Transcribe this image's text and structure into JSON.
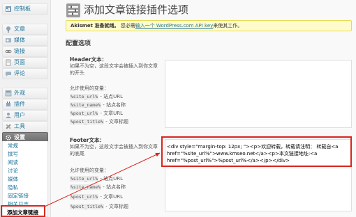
{
  "sidebar": {
    "items": [
      {
        "label": "控制板",
        "icon": "dashboard-icon"
      },
      {
        "label": "文章",
        "icon": "pin-icon"
      },
      {
        "label": "媒体",
        "icon": "media-icon"
      },
      {
        "label": "链接",
        "icon": "link-icon"
      },
      {
        "label": "页面",
        "icon": "page-icon"
      },
      {
        "label": "评论",
        "icon": "comment-icon"
      },
      {
        "label": "外观",
        "icon": "appearance-icon"
      },
      {
        "label": "插件",
        "icon": "plugin-icon"
      },
      {
        "label": "用户",
        "icon": "users-icon"
      },
      {
        "label": "工具",
        "icon": "tools-icon"
      },
      {
        "label": "设置",
        "icon": "settings-icon"
      }
    ],
    "submenu": [
      "常规",
      "撰写",
      "阅读",
      "讨论",
      "媒体",
      "隐私",
      "固定链接",
      "相关日志",
      "添加文章链接"
    ]
  },
  "page": {
    "title": "添加文章链接插件选项",
    "notice_bold": "Akismet 准备就绪。",
    "notice_pre": "您必需",
    "notice_link": "输入一个 WordPress.com API key",
    "notice_post": "来使其工作。",
    "section_title": "配置选项"
  },
  "header_field": {
    "label": "Header文本：",
    "desc": "如果不为空，这段文字会被插入到你文章的开头",
    "allowed": "允许使用的变量：",
    "vars": [
      {
        "code": "%site_url%",
        "desc": "- 站点URL"
      },
      {
        "code": "%site_name%",
        "desc": "- 站点名称"
      },
      {
        "code": "%post_url%",
        "desc": "- 文章URL"
      },
      {
        "code": "%post_title%",
        "desc": "- 文章标题"
      }
    ]
  },
  "footer_field": {
    "label": "Footer文本：",
    "desc": "如果不为空，这段文字会被插入到你文章的底尾",
    "value": "<div style=\"margin-top: 12px; \"><p>欢迎转载，转载请注明： 转载自<a href=\"%site_url%\">www.kmseo.net</a><p>本文链接地址:<a href=\"%post_url%\">%post_url%</a></p></div>",
    "allowed": "允许使用的变量：",
    "vars": [
      {
        "code": "%site_url%",
        "desc": "- 站点URL"
      },
      {
        "code": "%site_name%",
        "desc": "- 站点名称"
      },
      {
        "code": "%post_url%",
        "desc": "- 文章URL"
      },
      {
        "code": "%post_title%",
        "desc": "- 文章标题"
      }
    ]
  },
  "colors": {
    "link": "#21759b",
    "highlight": "#d9251d",
    "notice_bg": "#fffbcc"
  }
}
